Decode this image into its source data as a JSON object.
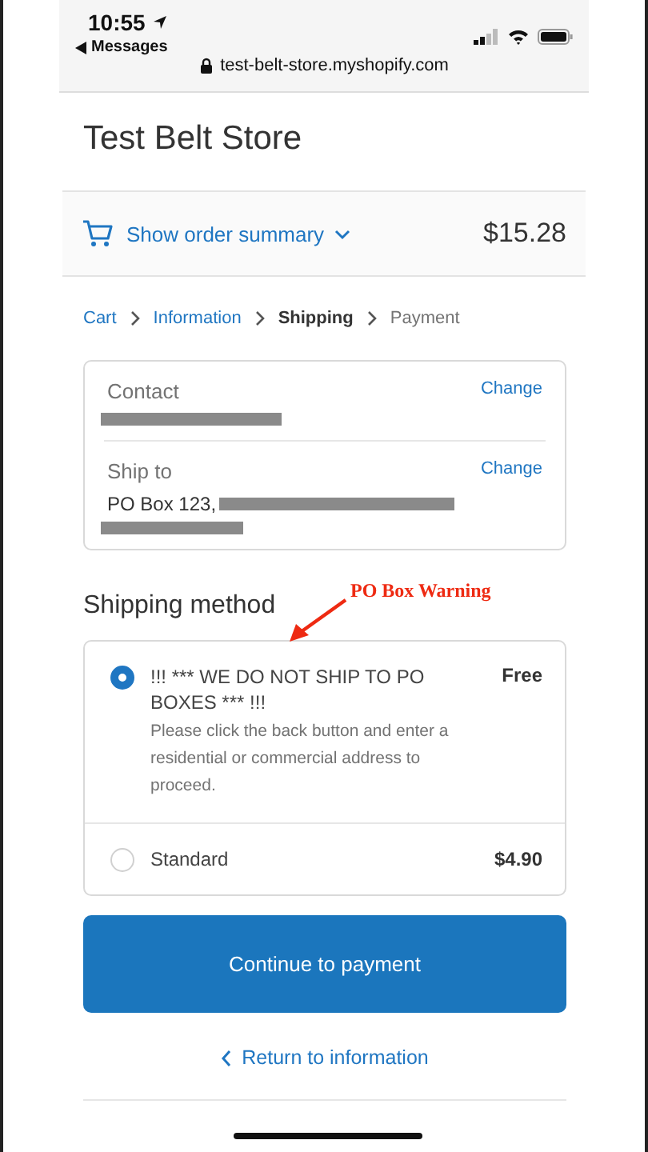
{
  "status_bar": {
    "time": "10:55",
    "back_app": "Messages",
    "url": "test-belt-store.myshopify.com"
  },
  "store_title": "Test Belt Store",
  "order_summary": {
    "label": "Show order summary",
    "total": "$15.28"
  },
  "breadcrumb": [
    {
      "label": "Cart",
      "selected": false
    },
    {
      "label": "Information",
      "selected": false
    },
    {
      "label": "Shipping",
      "selected": true
    },
    {
      "label": "Payment",
      "selected": false
    }
  ],
  "review": [
    {
      "label": "Contact",
      "action": "Change"
    },
    {
      "label": "Ship to",
      "value_prefix": "PO Box 123,",
      "action": "Change"
    }
  ],
  "shipping_method": {
    "heading": "Shipping method",
    "annotation": "PO Box Warning",
    "options": [
      {
        "title": "!!! *** WE DO NOT SHIP TO PO BOXES *** !!!",
        "description": "Please click the back button and enter a residential or commercial address to proceed.",
        "price": "Free",
        "selected": true
      },
      {
        "title": "Standard",
        "price": "$4.90",
        "selected": false
      }
    ]
  },
  "continue_button": "Continue to payment",
  "return_link": "Return to information"
}
